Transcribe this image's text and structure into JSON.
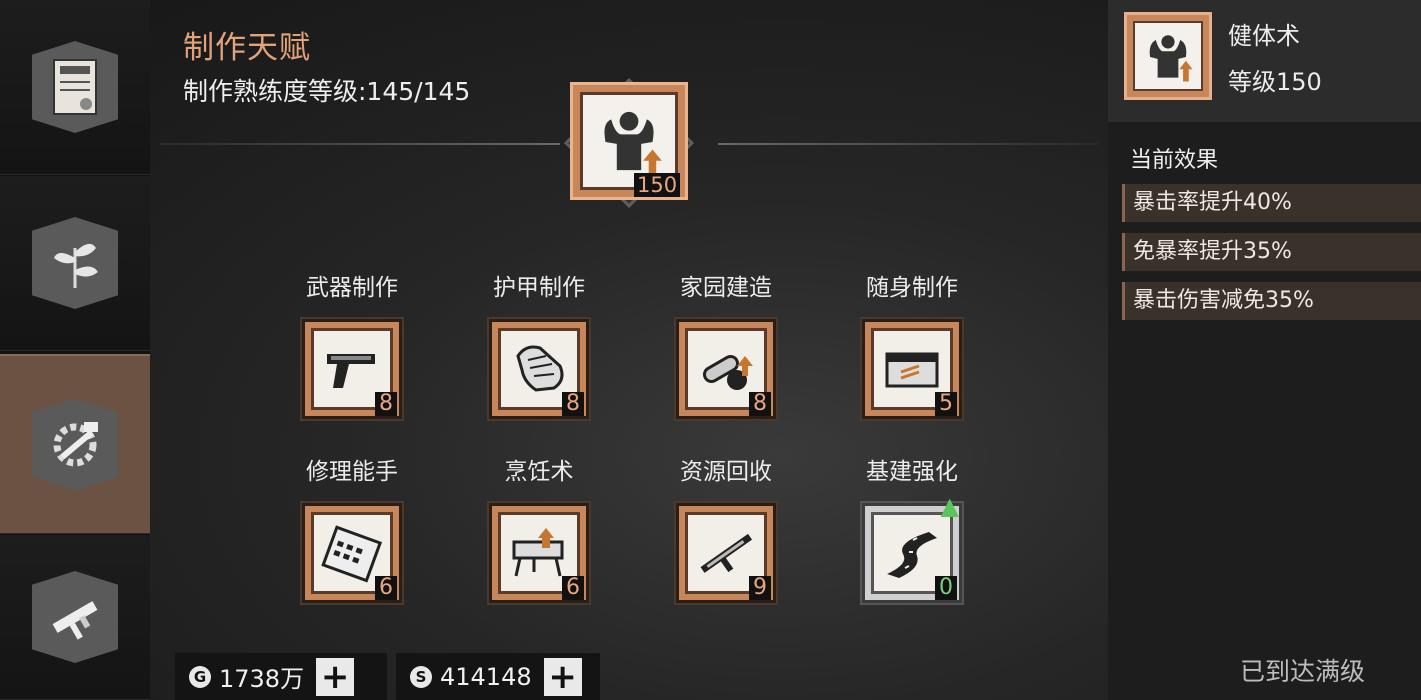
{
  "header": {
    "title": "制作天赋",
    "mastery_label": "制作熟练度等级:145/145"
  },
  "main_talent": {
    "icon": "bodybuilder-icon",
    "level": "150"
  },
  "sidebar": {
    "tabs": [
      {
        "icon": "trade-certificate-icon",
        "active": false
      },
      {
        "icon": "herb-badge-icon",
        "active": false
      },
      {
        "icon": "crafting-gear-hammer-icon",
        "active": true
      },
      {
        "icon": "smg-weapon-icon",
        "active": false
      }
    ]
  },
  "skills": [
    {
      "label": "武器制作",
      "icon": "pistol-icon",
      "level": "8"
    },
    {
      "label": "护甲制作",
      "icon": "glove-armor-icon",
      "level": "8"
    },
    {
      "label": "家园建造",
      "icon": "chainsaw-icon",
      "level": "8"
    },
    {
      "label": "随身制作",
      "icon": "toolbox-icon",
      "level": "5"
    },
    {
      "label": "修理能手",
      "icon": "calculator-icon",
      "level": "6"
    },
    {
      "label": "烹饪术",
      "icon": "grill-icon",
      "level": "6"
    },
    {
      "label": "资源回收",
      "icon": "rifle-icon",
      "level": "9"
    },
    {
      "label": "基建强化",
      "icon": "road-icon",
      "level": "0",
      "upgrade_available": true
    }
  ],
  "detail": {
    "name": "健体术",
    "level_text": "等级150",
    "effect_title": "当前效果",
    "effects": [
      "暴击率提升40%",
      "免暴率提升35%",
      "暴击伤害减免35%"
    ],
    "status": "已到达满级"
  },
  "currency": {
    "gold": {
      "icon": "gold-coin-icon",
      "value": "1738万"
    },
    "silver": {
      "icon": "silver-coin-icon",
      "value": "414148"
    }
  },
  "colors": {
    "accent": "#e2a27a",
    "tile": "#c7875a",
    "upgrade": "#5cc45c"
  }
}
